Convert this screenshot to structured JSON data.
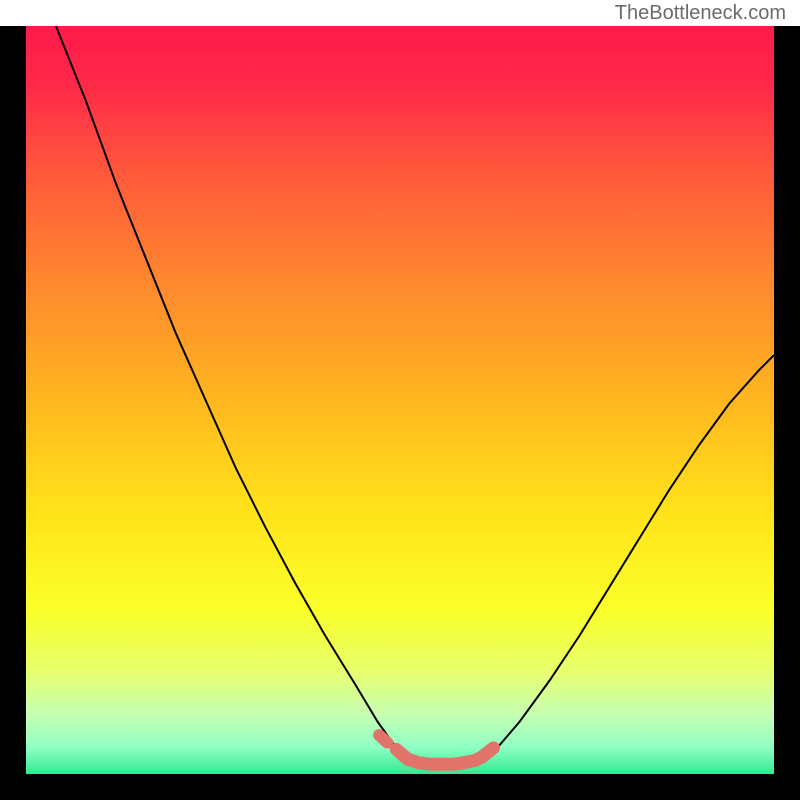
{
  "watermark": "TheBottleneck.com",
  "chart_data": {
    "type": "line",
    "title": "",
    "xlabel": "",
    "ylabel": "",
    "xlim": [
      0,
      100
    ],
    "ylim": [
      0,
      100
    ],
    "grid": false,
    "gradient_stops": [
      {
        "pos": 0.0,
        "color": "#ff1a4a"
      },
      {
        "pos": 0.08,
        "color": "#ff2a49"
      },
      {
        "pos": 0.2,
        "color": "#ff5a3a"
      },
      {
        "pos": 0.35,
        "color": "#ff8a2e"
      },
      {
        "pos": 0.5,
        "color": "#ffb61f"
      },
      {
        "pos": 0.65,
        "color": "#ffe31a"
      },
      {
        "pos": 0.78,
        "color": "#fbff29"
      },
      {
        "pos": 0.86,
        "color": "#e8ff6a"
      },
      {
        "pos": 0.92,
        "color": "#c6ffb3"
      },
      {
        "pos": 0.965,
        "color": "#8effc4"
      },
      {
        "pos": 1.0,
        "color": "#2fe990"
      }
    ],
    "series": [
      {
        "name": "left-curve",
        "stroke": "#000000",
        "stroke_width": 2,
        "x": [
          4,
          8,
          12,
          16,
          20,
          24,
          28,
          32,
          36,
          40,
          44,
          47,
          49.5,
          51
        ],
        "y": [
          100,
          90,
          79,
          69,
          59,
          50,
          41,
          33,
          25.5,
          18.5,
          12,
          7,
          3.5,
          2
        ]
      },
      {
        "name": "right-curve",
        "stroke": "#000000",
        "stroke_width": 2,
        "x": [
          61,
          63,
          66,
          70,
          74,
          78,
          82,
          86,
          90,
          94,
          98,
          100
        ],
        "y": [
          2,
          3.5,
          7,
          12.5,
          18.5,
          25,
          31.5,
          38,
          44,
          49.5,
          54,
          56
        ]
      },
      {
        "name": "bottom-highlight",
        "stroke": "#e2736b",
        "stroke_width": 13,
        "linecap": "round",
        "x": [
          49.5,
          51,
          52.5,
          54,
          55.5,
          57,
          58.5,
          60,
          61,
          62.5
        ],
        "y": [
          3.3,
          2,
          1.5,
          1.3,
          1.3,
          1.3,
          1.5,
          1.8,
          2.3,
          3.5
        ]
      },
      {
        "name": "bottom-highlight-dot-left",
        "stroke": "#e2736b",
        "stroke_width": 12,
        "linecap": "round",
        "x": [
          47.2,
          48.3
        ],
        "y": [
          5.2,
          4.2
        ]
      }
    ]
  }
}
